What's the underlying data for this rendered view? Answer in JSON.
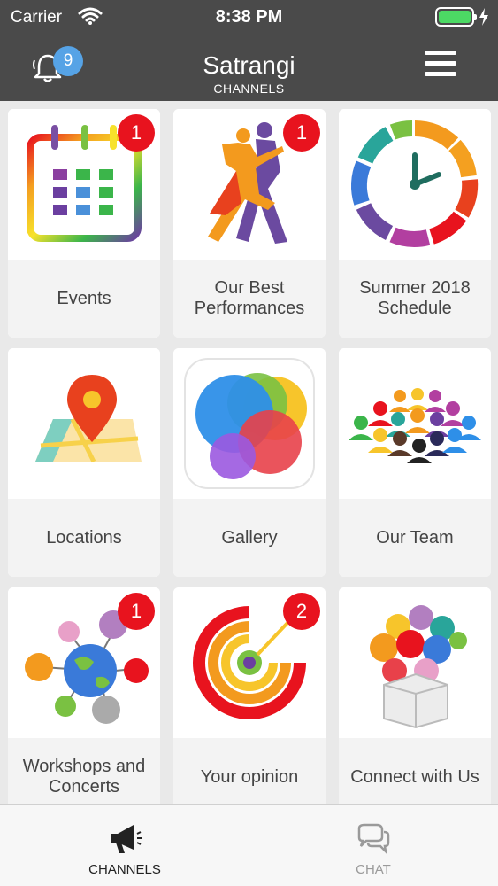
{
  "status_bar": {
    "carrier": "Carrier",
    "time": "8:38 PM",
    "battery_level": 1.0
  },
  "header": {
    "title": "Satrangi",
    "subtitle": "CHANNELS",
    "notification_count": "9",
    "icons": {
      "left": "bell-icon",
      "right": "hamburger-menu-icon"
    }
  },
  "tiles": [
    {
      "label": "Events",
      "badge": "1",
      "icon": "calendar-icon"
    },
    {
      "label": "Our Best Performances",
      "badge": "1",
      "icon": "dancers-icon"
    },
    {
      "label": "Summer 2018 Schedule",
      "badge": "",
      "icon": "clock-icon"
    },
    {
      "label": "Locations",
      "badge": "",
      "icon": "map-pin-icon"
    },
    {
      "label": "Gallery",
      "badge": "",
      "icon": "gallery-bubbles-icon"
    },
    {
      "label": "Our Team",
      "badge": "",
      "icon": "team-people-icon"
    },
    {
      "label": "Workshops and Concerts",
      "badge": "1",
      "icon": "globe-network-icon"
    },
    {
      "label": "Your opinion",
      "badge": "2",
      "icon": "target-spiral-icon"
    },
    {
      "label": "Connect with Us",
      "badge": "",
      "icon": "balloon-box-icon"
    }
  ],
  "tab_bar": {
    "tabs": [
      {
        "label": "CHANNELS",
        "icon": "megaphone-icon",
        "active": true
      },
      {
        "label": "CHAT",
        "icon": "chat-bubbles-icon",
        "active": false
      }
    ]
  },
  "colors": {
    "header_bg": "#4a4a4a",
    "badge_red": "#e8131e",
    "badge_blue": "#56a3e6",
    "tab_active": "#222222",
    "tab_inactive": "#9a9a9a"
  }
}
